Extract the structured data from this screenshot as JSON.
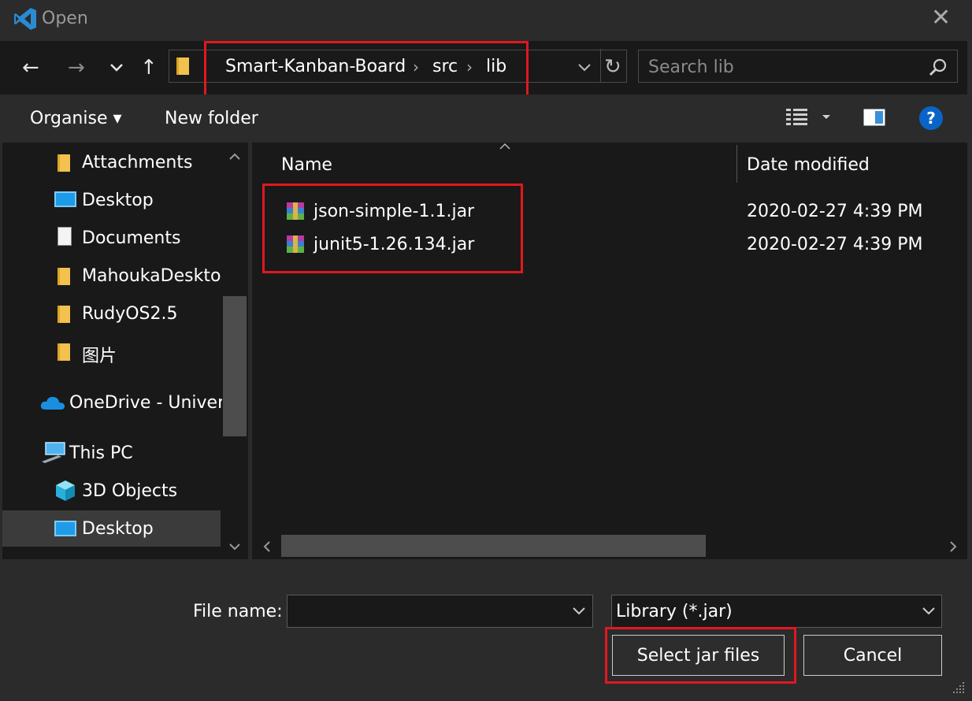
{
  "window": {
    "title": "Open",
    "close_glyph": "✕"
  },
  "nav": {
    "back": "←",
    "forward": "→",
    "recent": "⌄",
    "up": "↑",
    "refresh": "↻",
    "breadcrumb": [
      "Smart-Kanban-Board",
      "src",
      "lib"
    ],
    "breadcrumb_sep": "›",
    "search_placeholder": "Search lib"
  },
  "toolbar": {
    "organise": "Organise ▾",
    "new_folder": "New folder",
    "help": "?"
  },
  "sidebar": {
    "items": [
      {
        "label": "Attachments",
        "icon": "folder-icon"
      },
      {
        "label": "Desktop",
        "icon": "desktop-icon"
      },
      {
        "label": "Documents",
        "icon": "documents-icon"
      },
      {
        "label": "MahoukaDesktop",
        "icon": "folder-icon"
      },
      {
        "label": "RudyOS2.5",
        "icon": "folder-icon"
      },
      {
        "label": "图片",
        "icon": "folder-icon"
      },
      {
        "label": "OneDrive - Univer",
        "icon": "cloud-icon"
      },
      {
        "label": "This PC",
        "icon": "computer-icon"
      },
      {
        "label": "3D Objects",
        "icon": "cube-icon"
      },
      {
        "label": "Desktop",
        "icon": "desktop-icon"
      }
    ]
  },
  "columns": {
    "name": "Name",
    "date_modified": "Date modified"
  },
  "files": [
    {
      "name": "json-simple-1.1.jar",
      "date": "2020-02-27 4:39 PM",
      "icon": "archive-icon"
    },
    {
      "name": "junit5-1.26.134.jar",
      "date": "2020-02-27 4:39 PM",
      "icon": "archive-icon"
    }
  ],
  "footer": {
    "file_name_label": "File name:",
    "file_name_value": "",
    "file_type": "Library (*.jar)",
    "primary_button": "Select jar files",
    "cancel_button": "Cancel"
  },
  "colors": {
    "highlight": "#e0181f",
    "accent": "#0078d7"
  }
}
